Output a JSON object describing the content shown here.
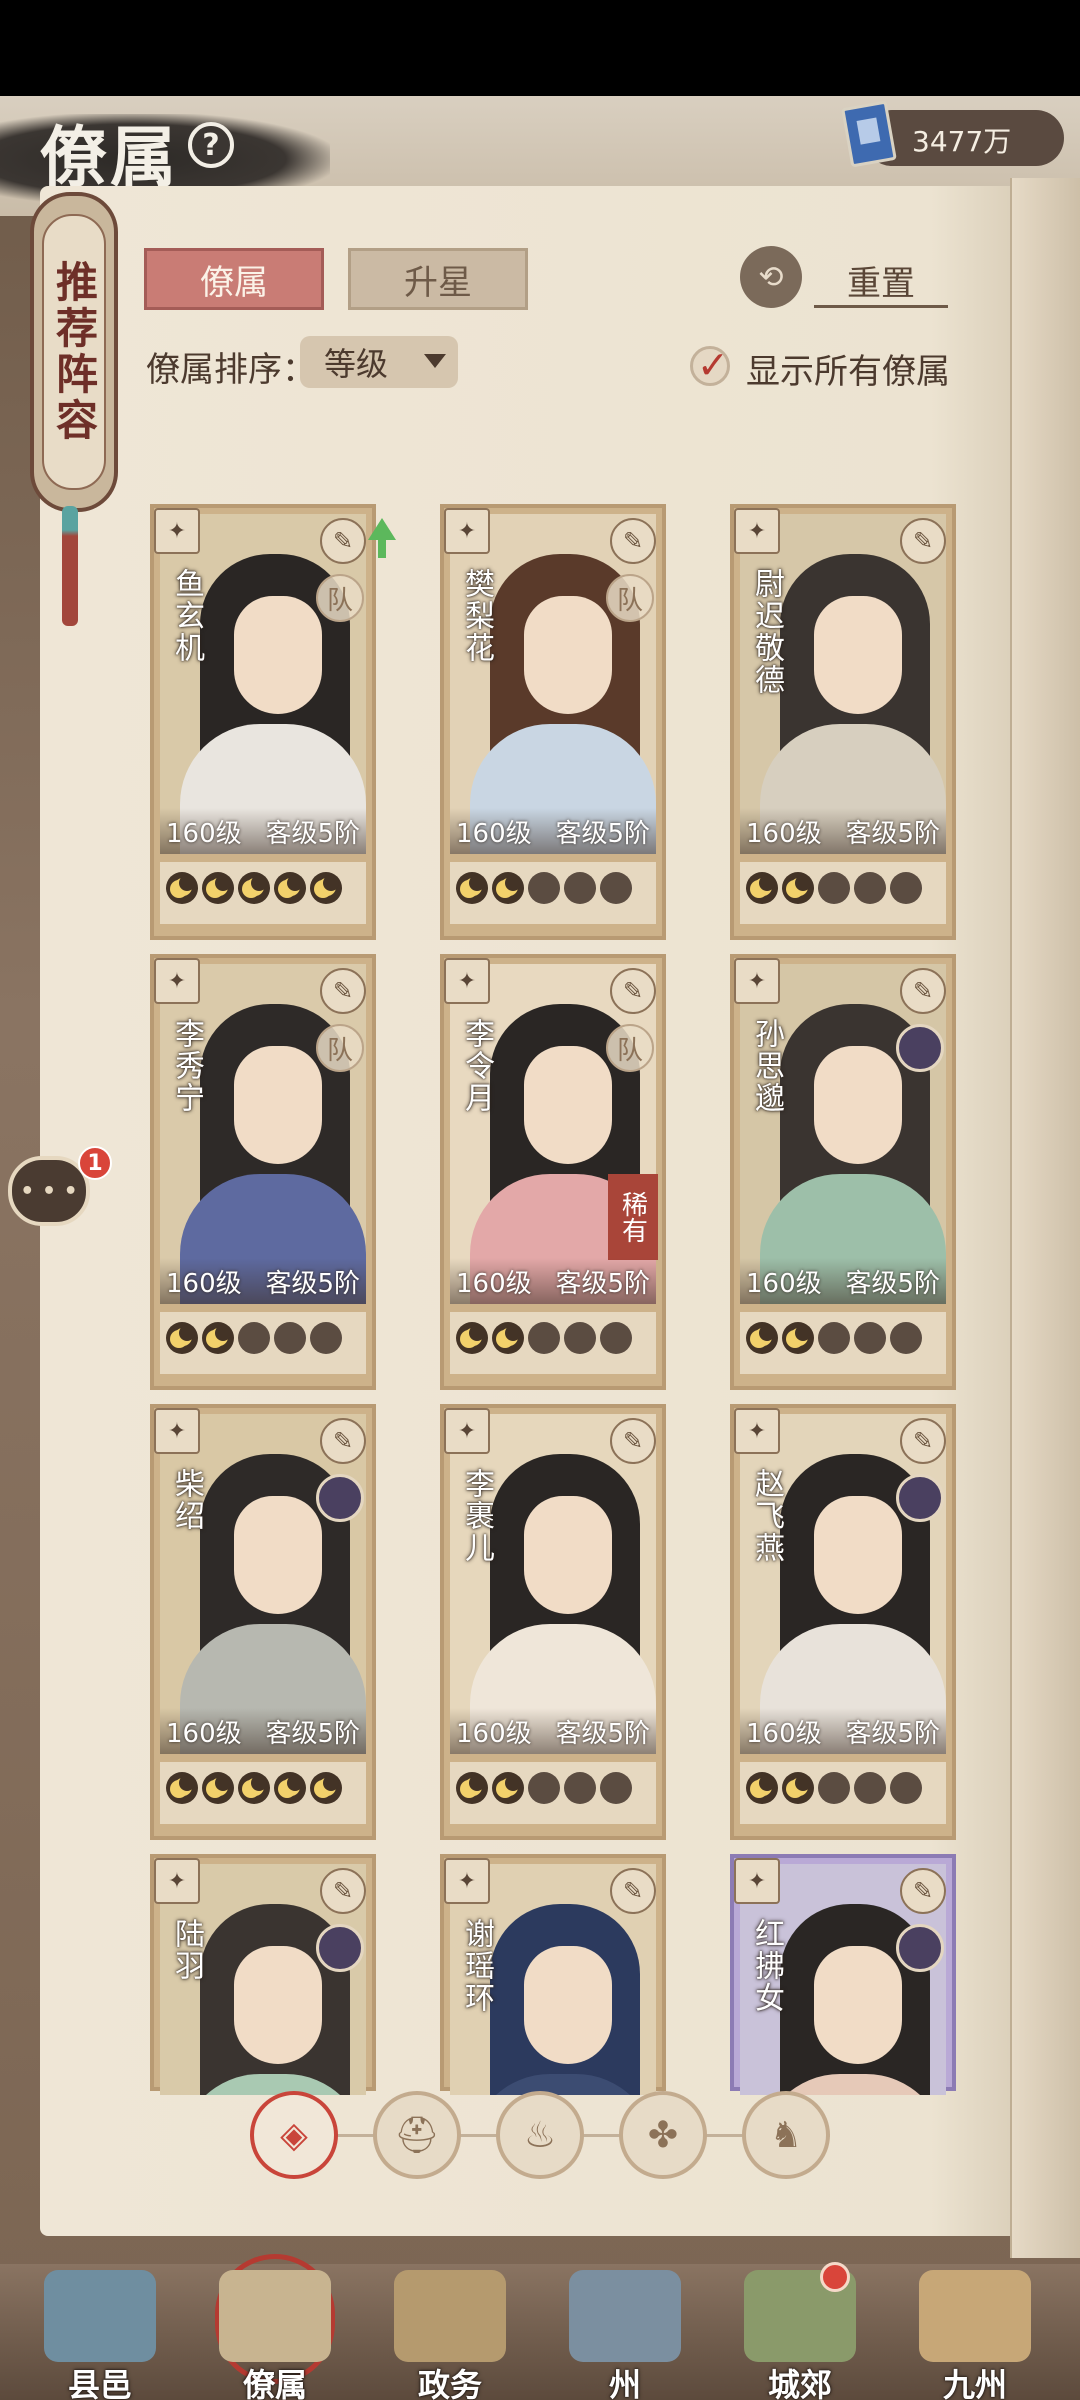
{
  "header": {
    "title": "僚属",
    "help_symbol": "?",
    "currency_value": "3477万",
    "currency_icon": "book-icon"
  },
  "banner": {
    "text": "推荐阵容"
  },
  "tabs": [
    {
      "label": "僚属",
      "active": true
    },
    {
      "label": "升星",
      "active": false
    }
  ],
  "reset": {
    "label": "重置",
    "icon": "reset-icon"
  },
  "sort": {
    "label": "僚属排序：",
    "selected": "等级"
  },
  "show_all": {
    "label": "显示所有僚属",
    "checked": true
  },
  "cards": [
    {
      "name": "鱼玄机",
      "level": "160级",
      "rank": "客级5阶",
      "team": "队",
      "stars": 5,
      "upgrade": true,
      "colors": {
        "bg": "#d9c9a8",
        "hair": "#2a2624",
        "body": "#e9e5df"
      }
    },
    {
      "name": "樊梨花",
      "level": "160级",
      "rank": "客级5阶",
      "team": "队",
      "stars": 2,
      "colors": {
        "bg": "#e2d2b6",
        "hair": "#5a3a2a",
        "body": "#c9d6e3"
      }
    },
    {
      "name": "尉迟敬德",
      "level": "160级",
      "rank": "客级5阶",
      "stars": 2,
      "colors": {
        "bg": "#d6c7a8",
        "hair": "#3a3430",
        "body": "#d7cfbf"
      }
    },
    {
      "name": "李秀宁",
      "level": "160级",
      "rank": "客级5阶",
      "team": "队",
      "stars": 2,
      "colors": {
        "bg": "#dacaaa",
        "hair": "#2e2a28",
        "body": "#5e6aa0"
      }
    },
    {
      "name": "李令月",
      "level": "160级",
      "rank": "客级5阶",
      "team": "队",
      "stars": 2,
      "rare": "稀有",
      "colors": {
        "bg": "#e8d9c0",
        "hair": "#2a2624",
        "body": "#e3a8a8"
      }
    },
    {
      "name": "孙思邈",
      "level": "160级",
      "rank": "客级5阶",
      "stars": 2,
      "portrait": true,
      "colors": {
        "bg": "#d5c6a6",
        "hair": "#3a3430",
        "body": "#9dbfa9"
      }
    },
    {
      "name": "柴绍",
      "level": "160级",
      "rank": "客级5阶",
      "stars": 5,
      "portrait": true,
      "colors": {
        "bg": "#d9c8a5",
        "hair": "#2e2a28",
        "body": "#b7b8b0"
      }
    },
    {
      "name": "李裹儿",
      "level": "160级",
      "rank": "客级5阶",
      "stars": 2,
      "colors": {
        "bg": "#e6d7bc",
        "hair": "#2a2624",
        "body": "#efe6d9"
      }
    },
    {
      "name": "赵飞燕",
      "level": "160级",
      "rank": "客级5阶",
      "stars": 2,
      "portrait": true,
      "colors": {
        "bg": "#e3d5ba",
        "hair": "#2a2624",
        "body": "#e8e2da"
      }
    },
    {
      "name": "陆羽",
      "stars": 0,
      "portrait": true,
      "colors": {
        "bg": "#d9caa9",
        "hair": "#3a3430",
        "body": "#a9c9b2"
      }
    },
    {
      "name": "谢瑶环",
      "stars": 0,
      "colors": {
        "bg": "#e0d0b2",
        "hair": "#2c3a5e",
        "body": "#3c4c72"
      }
    },
    {
      "name": "红拂女",
      "stars": 0,
      "portrait": true,
      "special": true,
      "colors": {
        "bg": "#c9c2d9",
        "hair": "#2a2624",
        "body": "#e6c9b8"
      }
    }
  ],
  "filters": [
    {
      "icon": "all-diamond-icon",
      "glyph": "◈",
      "active": true
    },
    {
      "icon": "helmet-icon",
      "glyph": "⛑",
      "active": false
    },
    {
      "icon": "gourd-icon",
      "glyph": "♨",
      "active": false
    },
    {
      "icon": "fan-icon",
      "glyph": "✤",
      "active": false
    },
    {
      "icon": "lion-icon",
      "glyph": "♞",
      "active": false
    }
  ],
  "chat": {
    "badge": "1"
  },
  "bottom_nav": [
    {
      "label": "县邑",
      "active": false,
      "dot": false,
      "color": "#6f8ea0"
    },
    {
      "label": "僚属",
      "active": true,
      "dot": false,
      "color": "#c8b490"
    },
    {
      "label": "政务",
      "active": false,
      "dot": false,
      "color": "#b59a6e"
    },
    {
      "label": "州",
      "active": false,
      "dot": false,
      "color": "#7b8fa0"
    },
    {
      "label": "城郊",
      "active": false,
      "dot": true,
      "color": "#8a9a6a"
    },
    {
      "label": "九州",
      "active": false,
      "dot": false,
      "color": "#c7a777"
    }
  ]
}
